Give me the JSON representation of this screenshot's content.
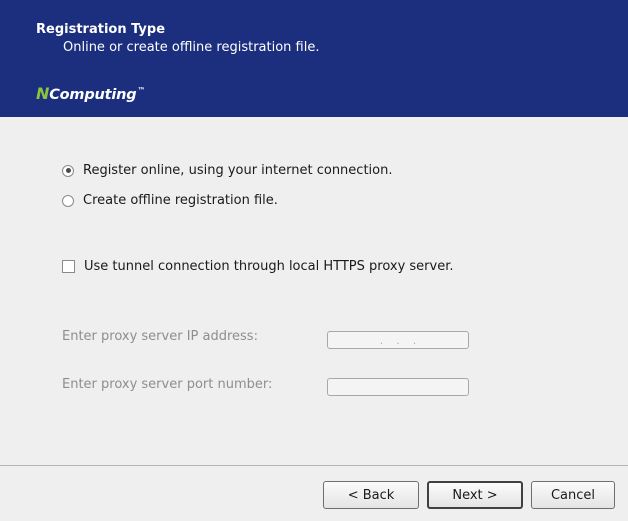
{
  "header": {
    "title": "Registration Type",
    "subtitle": "Online or create offline registration file.",
    "brand_mark": "N",
    "brand_text": "Computing",
    "brand_tm": "™",
    "background_color": "#1b2f7e",
    "brand_accent_color": "#8bc53f"
  },
  "options": {
    "online_label": "Register online, using your internet connection.",
    "online_selected": true,
    "offline_label": "Create offline registration file.",
    "offline_selected": false
  },
  "proxy": {
    "tunnel_label": "Use tunnel connection through local HTTPS proxy server.",
    "tunnel_checked": false,
    "ip_label": "Enter proxy server IP address:",
    "ip_value": "...",
    "port_label": "Enter proxy server port number:",
    "port_value": ""
  },
  "buttons": {
    "back": "< Back",
    "next": "Next >",
    "cancel": "Cancel"
  }
}
